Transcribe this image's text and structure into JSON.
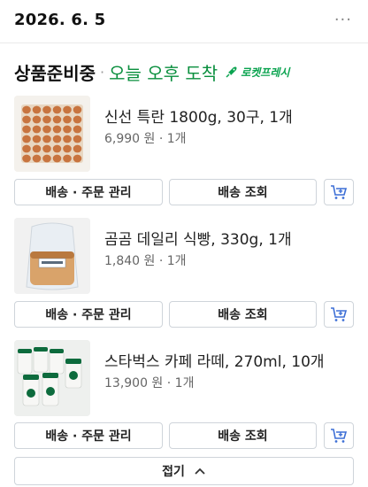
{
  "header": {
    "date": "2026. 6. 5",
    "more_label": "···"
  },
  "status": {
    "title": "상품준비중",
    "separator": "·",
    "eta": "오늘 오후 도착",
    "badge_label": "로켓프레시",
    "accent_color": "#0a8f3e"
  },
  "items": [
    {
      "name": "신선 특란 1800g, 30구, 1개",
      "price": "6,990 원 · 1개",
      "thumbnail_icon": "egg-tray-icon"
    },
    {
      "name": "곰곰 데일리 식빵, 330g, 1개",
      "price": "1,840 원 · 1개",
      "thumbnail_icon": "bread-bag-icon"
    },
    {
      "name": "스타벅스 카페 라떼, 270ml, 10개",
      "price": "13,900 원 · 1개",
      "thumbnail_icon": "latte-cups-icon"
    }
  ],
  "buttons": {
    "manage": "배송 · 주문 관리",
    "track": "배송 조회",
    "cart_icon": "cart-add-icon"
  },
  "footer": {
    "collapse_label": "접기"
  }
}
